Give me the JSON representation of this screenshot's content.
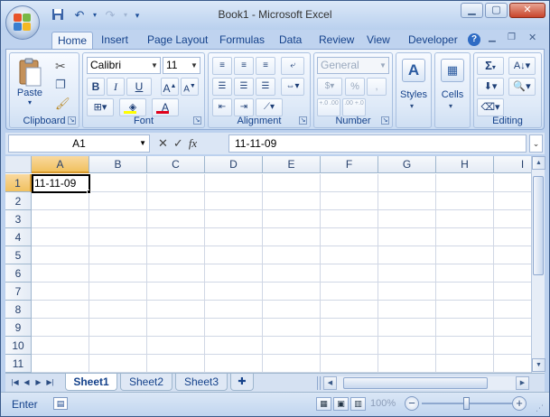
{
  "window": {
    "title": "Book1 - Microsoft Excel"
  },
  "tabs": [
    "Home",
    "Insert",
    "Page Layout",
    "Formulas",
    "Data",
    "Review",
    "View",
    "Developer"
  ],
  "active_tab": "Home",
  "ribbon": {
    "clipboard": {
      "label": "Clipboard",
      "paste": "Paste"
    },
    "font": {
      "label": "Font",
      "name": "Calibri",
      "size": "11",
      "bold": "B",
      "italic": "I",
      "underline": "U"
    },
    "alignment": {
      "label": "Alignment"
    },
    "number": {
      "label": "Number",
      "format": "General",
      "percent": "%",
      "comma": ",",
      "inc_decimal": "+.0 .00",
      "dec_decimal": ".00 +.0"
    },
    "styles": {
      "label": "Styles"
    },
    "cells": {
      "label": "Cells"
    },
    "editing": {
      "label": "Editing",
      "sum": "Σ"
    }
  },
  "formula_bar": {
    "name_box": "A1",
    "fx": "fx",
    "value": "11-11-09"
  },
  "grid": {
    "columns": [
      "A",
      "B",
      "C",
      "D",
      "E",
      "F",
      "G",
      "H",
      "I"
    ],
    "rows": [
      "1",
      "2",
      "3",
      "4",
      "5",
      "6",
      "7",
      "8",
      "9",
      "10",
      "11"
    ],
    "active_cell_value": "11-11-09"
  },
  "sheets": [
    "Sheet1",
    "Sheet2",
    "Sheet3"
  ],
  "active_sheet": "Sheet1",
  "status": {
    "mode": "Enter",
    "zoom": "100%"
  },
  "colors": {
    "selected_header": "#f1c15f",
    "ribbon_blue": "#15428b",
    "close_red": "#c8442b"
  }
}
